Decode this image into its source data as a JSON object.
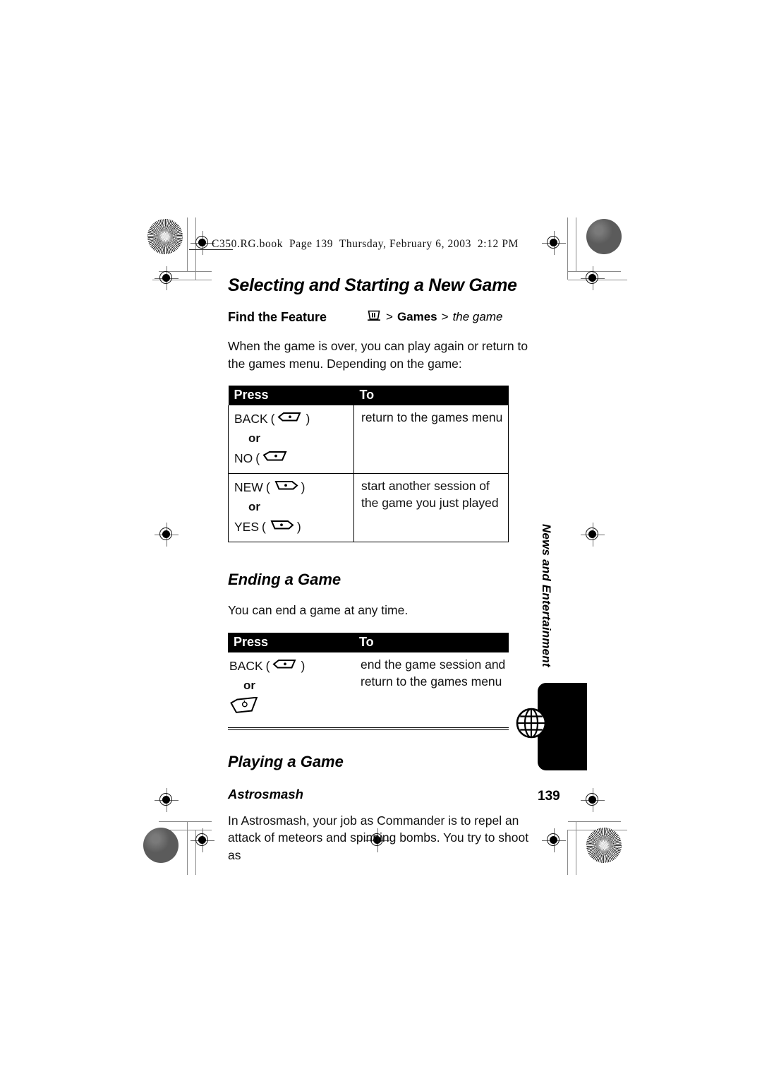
{
  "print_header": {
    "text": "C350.RG.book  Page 139  Thursday, February 6, 2003  2:12 PM"
  },
  "section1": {
    "title": "Selecting and Starting a New Game",
    "find_the_feature": {
      "label": "Find the Feature",
      "menu_icon": "menu-key-icon",
      "sep1": ">",
      "item1": "Games",
      "sep2": ">",
      "item2": "the game"
    },
    "intro": "When the game is over, you can play again or return to the games menu. Depending on the game:",
    "table": {
      "headers": [
        "Press",
        "To"
      ],
      "rows": [
        {
          "press": [
            {
              "label": "BACK",
              "icon": "right-softkey-icon",
              "parens": true
            },
            {
              "label": "or",
              "icon": null,
              "parens": false
            },
            {
              "label": "NO",
              "icon": "right-softkey-icon",
              "parens": true
            }
          ],
          "to": "return to the games menu"
        },
        {
          "press": [
            {
              "label": "NEW",
              "icon": "left-softkey-icon",
              "parens": true
            },
            {
              "label": "or",
              "icon": null,
              "parens": false
            },
            {
              "label": "YES",
              "icon": "left-softkey-icon",
              "parens": true
            }
          ],
          "to": "start another session of the game you just played"
        }
      ]
    }
  },
  "section2": {
    "title": "Ending a Game",
    "intro": "You can end a game at any time.",
    "table": {
      "headers": [
        "Press",
        "To"
      ],
      "rows": [
        {
          "press": [
            {
              "label": "BACK",
              "icon": "right-softkey-icon",
              "parens": true
            },
            {
              "label": "or",
              "icon": null,
              "parens": false
            },
            {
              "label": "",
              "icon": "end-key-icon",
              "parens": false
            }
          ],
          "to": "end the game session and return to the games menu"
        }
      ]
    }
  },
  "section3": {
    "title": "Playing a Game",
    "subtitle": "Astrosmash",
    "body": "In Astrosmash, your job as Commander is to repel an attack of meteors and spinning bombs. You try to shoot as"
  },
  "side_tab": {
    "label": "News and Entertainment",
    "icon": "globe-icon"
  },
  "page_number": "139",
  "colors": {
    "table_header_bg": "#000000",
    "table_header_fg": "#ffffff",
    "text": "#111111",
    "rule": "#8a8a8a"
  }
}
